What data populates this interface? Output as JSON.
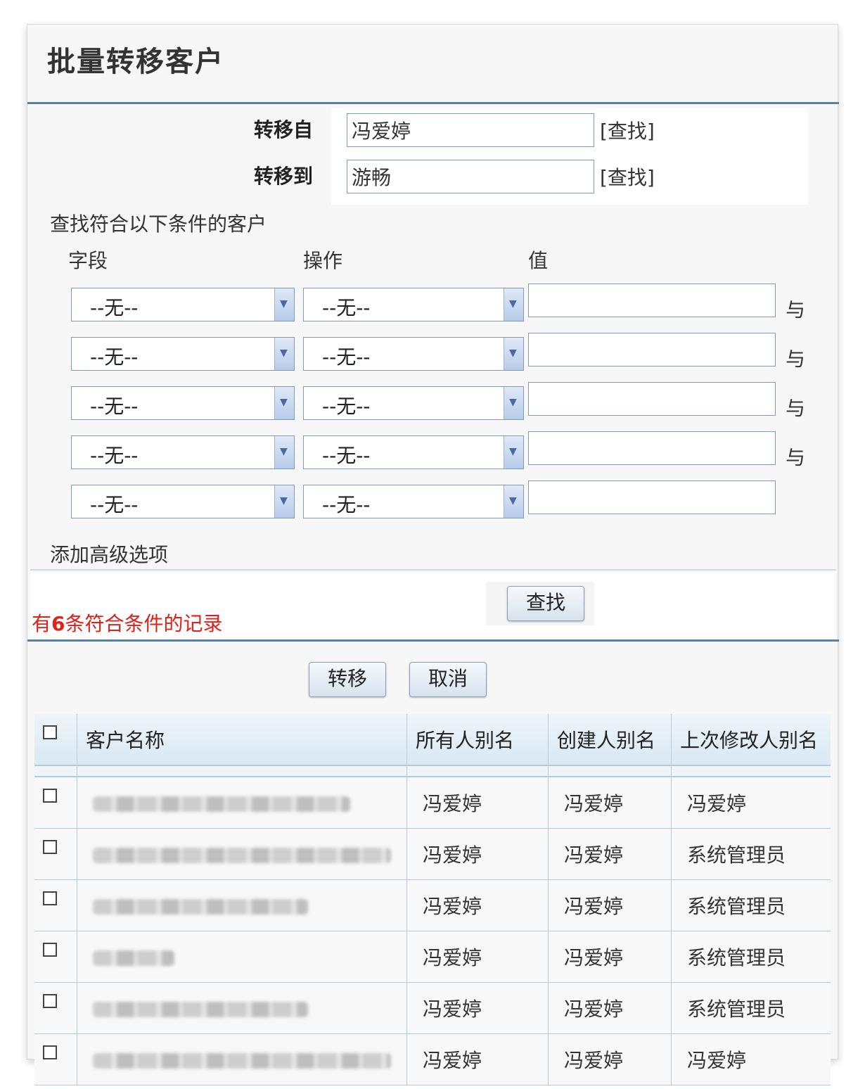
{
  "page": {
    "title": "批量转移客户"
  },
  "transfer": {
    "from_label": "转移自",
    "from_value": "冯爱婷",
    "to_label": "转移到",
    "to_value": "游畅",
    "lookup_label": "[查找]"
  },
  "filter": {
    "heading": "查找符合以下条件的客户",
    "col_field": "字段",
    "col_operator": "操作",
    "col_value": "值",
    "rows": [
      {
        "field": "--无--",
        "operator": "--无--",
        "value": "",
        "conj": "与"
      },
      {
        "field": "--无--",
        "operator": "--无--",
        "value": "",
        "conj": "与"
      },
      {
        "field": "--无--",
        "operator": "--无--",
        "value": "",
        "conj": "与"
      },
      {
        "field": "--无--",
        "operator": "--无--",
        "value": "",
        "conj": "与"
      },
      {
        "field": "--无--",
        "operator": "--无--",
        "value": "",
        "conj": ""
      }
    ],
    "advanced_link": "添加高级选项",
    "search_button": "查找"
  },
  "result": {
    "prefix": "有",
    "count": "6",
    "suffix": "条符合条件的记录"
  },
  "actions": {
    "transfer_button": "转移",
    "cancel_button": "取消"
  },
  "table": {
    "headers": [
      "客户名称",
      "所有人别名",
      "创建人别名",
      "上次修改人别名"
    ],
    "rows": [
      {
        "owner": "冯爱婷",
        "creator": "冯爱婷",
        "modifier": "冯爱婷"
      },
      {
        "owner": "冯爱婷",
        "creator": "冯爱婷",
        "modifier": "系统管理员"
      },
      {
        "owner": "冯爱婷",
        "creator": "冯爱婷",
        "modifier": "系统管理员"
      },
      {
        "owner": "冯爱婷",
        "creator": "冯爱婷",
        "modifier": "系统管理员"
      },
      {
        "owner": "冯爱婷",
        "creator": "冯爱婷",
        "modifier": "系统管理员"
      },
      {
        "owner": "冯爱婷",
        "creator": "冯爱婷",
        "modifier": "冯爱婷"
      }
    ]
  }
}
